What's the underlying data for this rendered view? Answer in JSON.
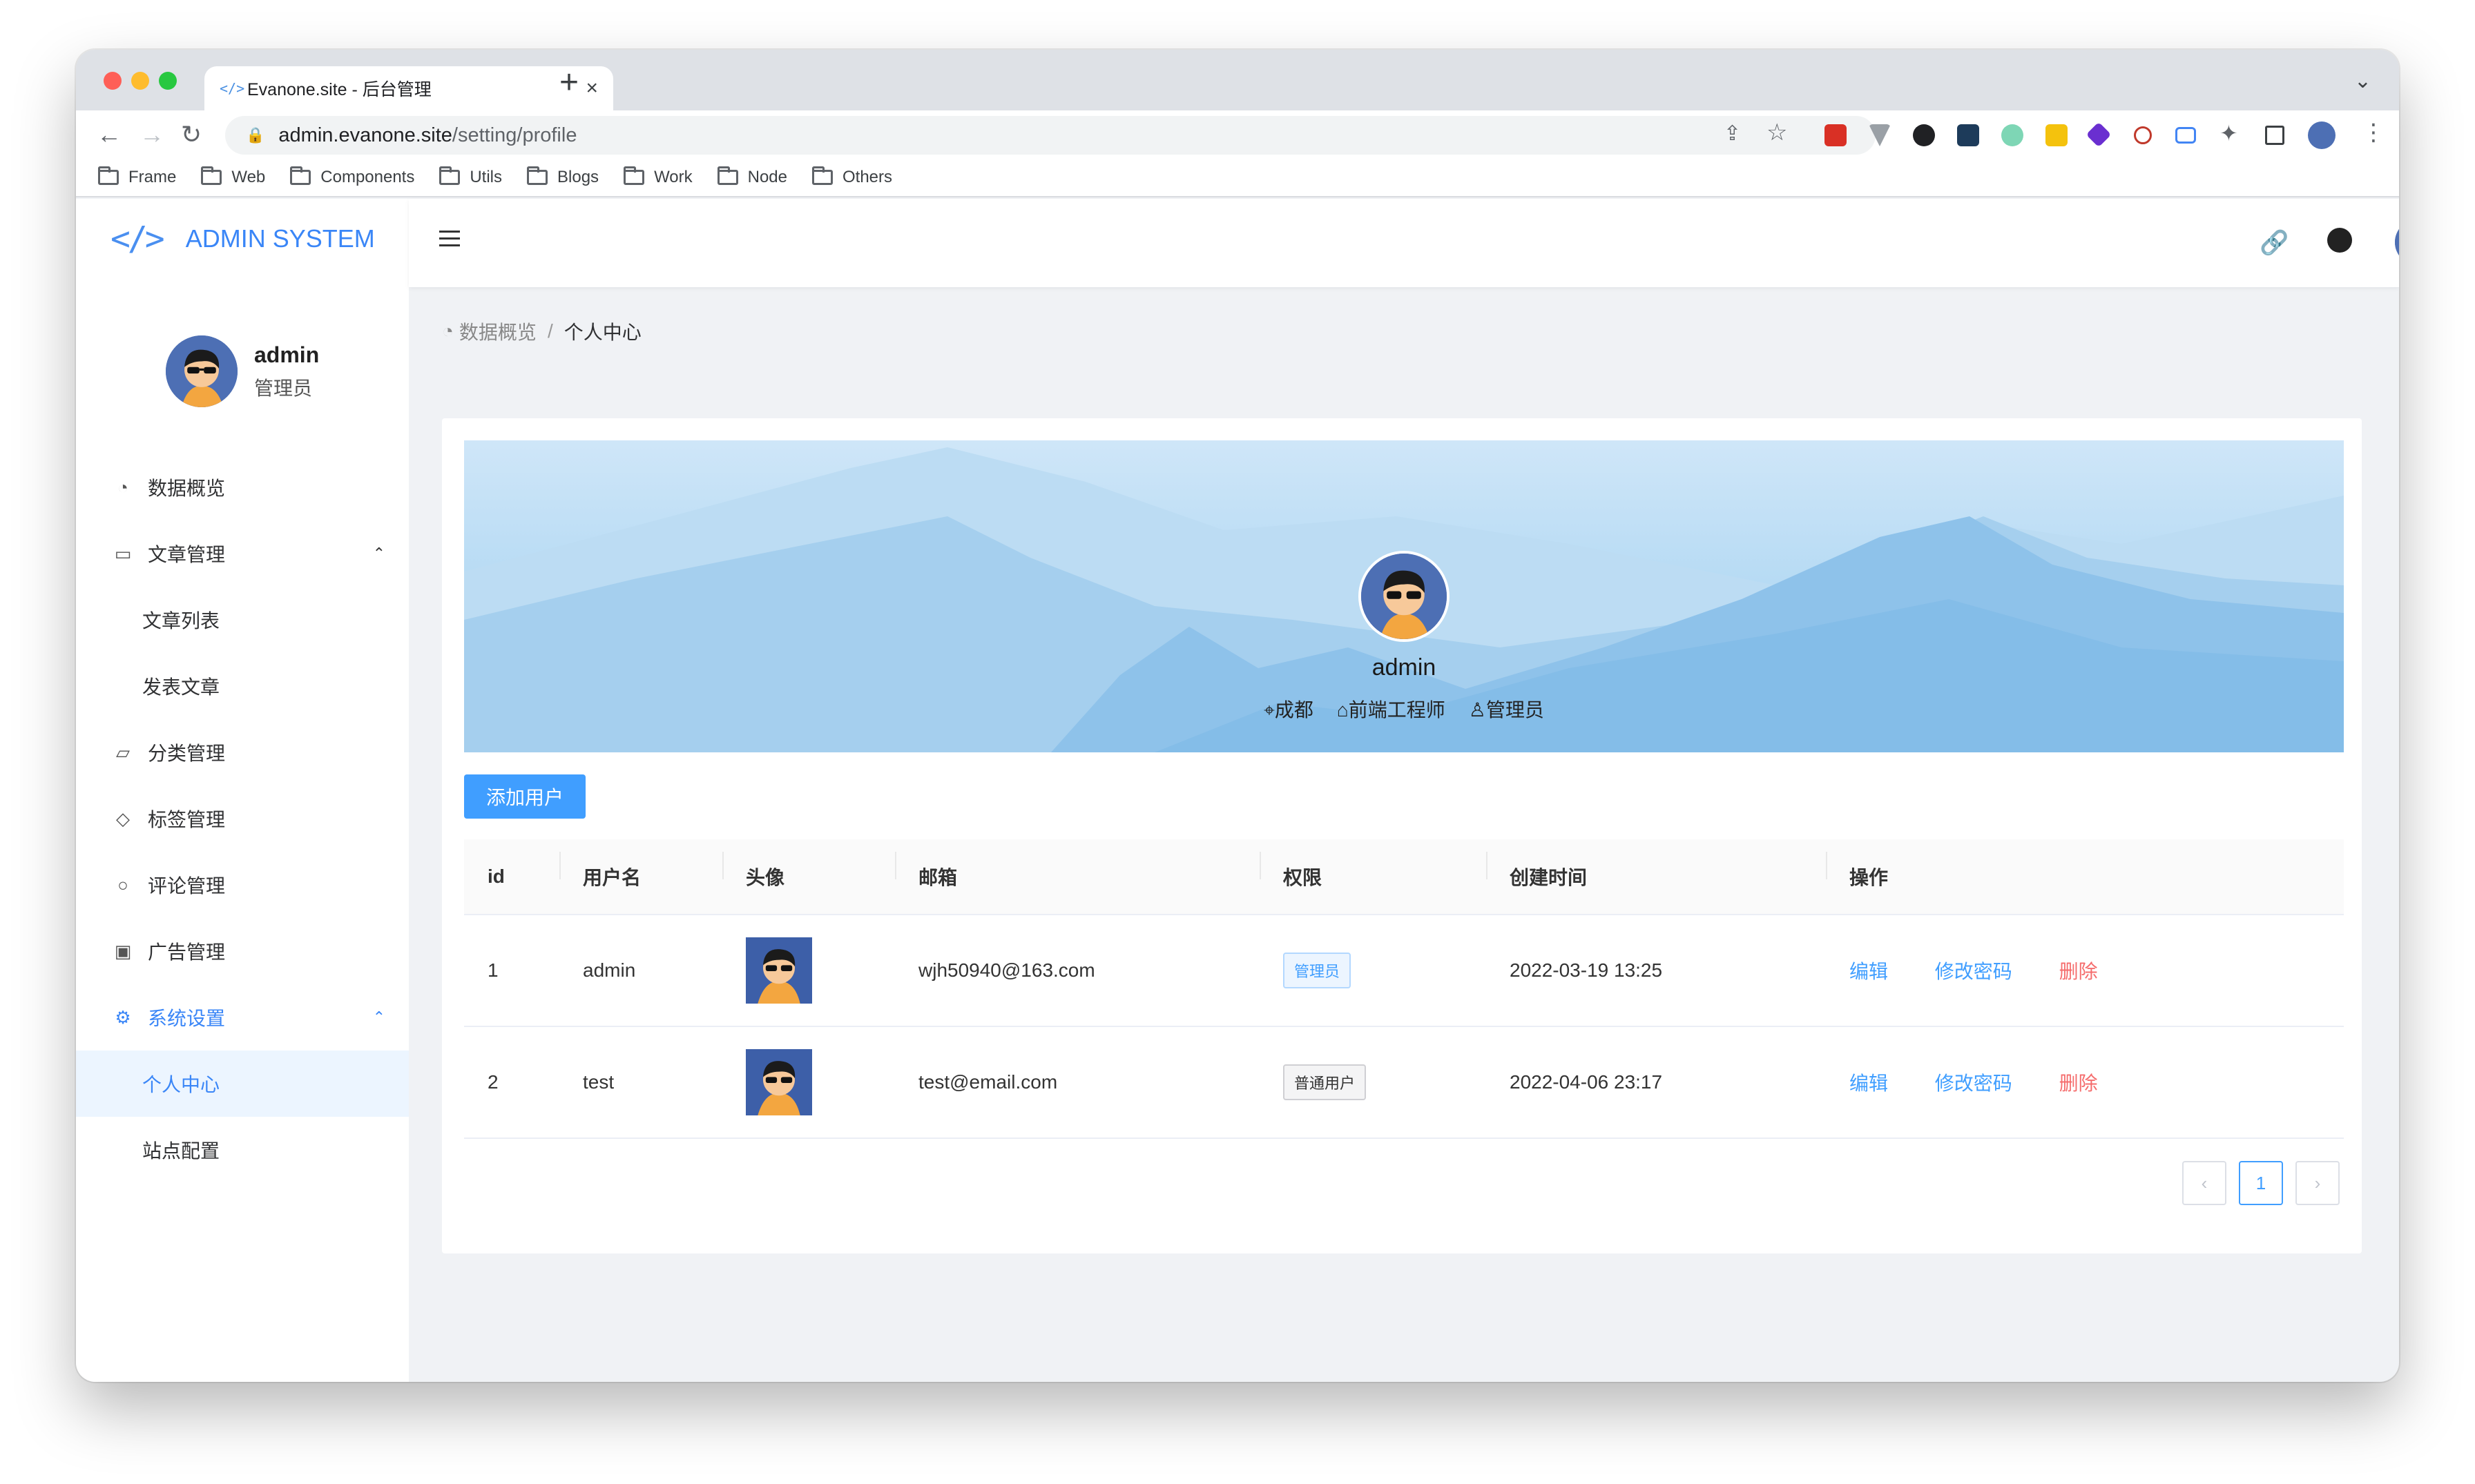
{
  "browser": {
    "tab_title": "Evanone.site - 后台管理",
    "tab_favicon": "</>",
    "url_host": "admin.evanone.site",
    "url_path": "/setting/profile",
    "bookmarks": [
      "Frame",
      "Web",
      "Components",
      "Utils",
      "Blogs",
      "Work",
      "Node",
      "Others"
    ]
  },
  "app": {
    "logo_mark": "</>",
    "title": "ADMIN SYSTEM",
    "accent": "#409eff"
  },
  "user": {
    "name": "admin",
    "role": "管理员"
  },
  "menu": {
    "items": [
      {
        "label": "数据概览",
        "icon": "dashboard-icon"
      },
      {
        "label": "文章管理",
        "icon": "document-icon"
      },
      {
        "label": "文章列表"
      },
      {
        "label": "发表文章"
      },
      {
        "label": "分类管理",
        "icon": "folder-open-icon"
      },
      {
        "label": "标签管理",
        "icon": "tag-icon"
      },
      {
        "label": "评论管理",
        "icon": "comment-icon"
      },
      {
        "label": "广告管理",
        "icon": "picture-icon"
      },
      {
        "label": "系统设置",
        "icon": "setting-icon"
      },
      {
        "label": "个人中心"
      },
      {
        "label": "站点配置"
      }
    ]
  },
  "breadcrumb": {
    "home": "数据概览",
    "sep": "/",
    "current": "个人中心"
  },
  "profile": {
    "name": "admin",
    "location": "成都",
    "job": "前端工程师",
    "role": "管理员"
  },
  "add_user_label": "添加用户",
  "table": {
    "columns": [
      "id",
      "用户名",
      "头像",
      "邮箱",
      "权限",
      "创建时间",
      "操作"
    ],
    "rows": [
      {
        "id": "1",
        "username": "admin",
        "email": "wjh50940@163.com",
        "role": "管理员",
        "created": "2022-03-19 13:25"
      },
      {
        "id": "2",
        "username": "test",
        "email": "test@email.com",
        "role": "普通用户",
        "created": "2022-04-06 23:17"
      }
    ],
    "actions": {
      "edit": "编辑",
      "password": "修改密码",
      "delete": "删除"
    }
  },
  "pagination": {
    "prev": "‹",
    "current": "1",
    "next": "›"
  }
}
